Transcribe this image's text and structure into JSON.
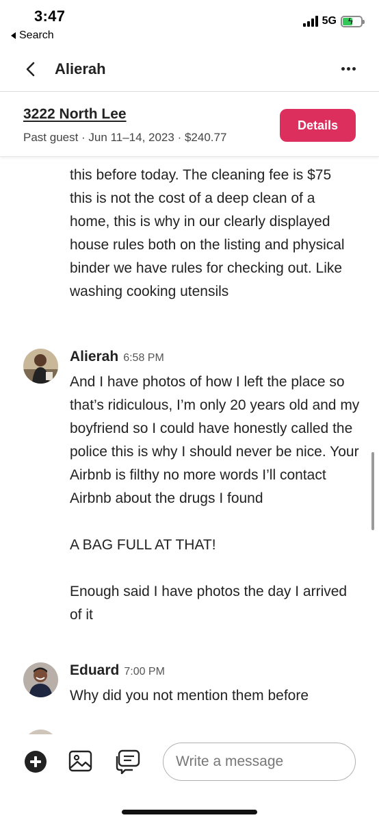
{
  "status_bar": {
    "time": "3:47",
    "back_label": "Search",
    "network": "5G",
    "icons": [
      "signal-bars-icon",
      "battery-charging-icon"
    ],
    "battery_fill_percent": 55
  },
  "header": {
    "title": "Alierah",
    "back_icon": "chevron-left-icon",
    "more_icon": "ellipsis-icon"
  },
  "banner": {
    "listing_name": "3222 North Lee",
    "meta": "Past guest · Jun 11–14, 2023 · $240.77",
    "details_label": "Details",
    "details_color": "#dd2f5e"
  },
  "thread": {
    "previous_message_text": "this before today. The cleaning fee is $75 this is not the cost of a deep clean of a home, this is why in our clearly displayed house rules both on the listing and physical binder we have rules for checking out. Like washing cooking utensils",
    "messages": [
      {
        "sender": "Alierah",
        "time": "6:58 PM",
        "text": "And I have photos of how I left the place so that’s ridiculous, I’m only 20 years old and my boyfriend so I could have honestly called the police this is why I should never be nice. Your Airbnb is filthy no more words I’ll contact Airbnb about the drugs I found\n\nA BAG FULL AT THAT!\n\nEnough said I have photos the day I arrived of it"
      },
      {
        "sender": "Eduard",
        "time": "7:00 PM",
        "text": "Why did you not mention them before"
      }
    ]
  },
  "composer": {
    "placeholder": "Write a message",
    "icons": [
      "plus-icon",
      "image-icon",
      "quick-reply-icon"
    ]
  }
}
